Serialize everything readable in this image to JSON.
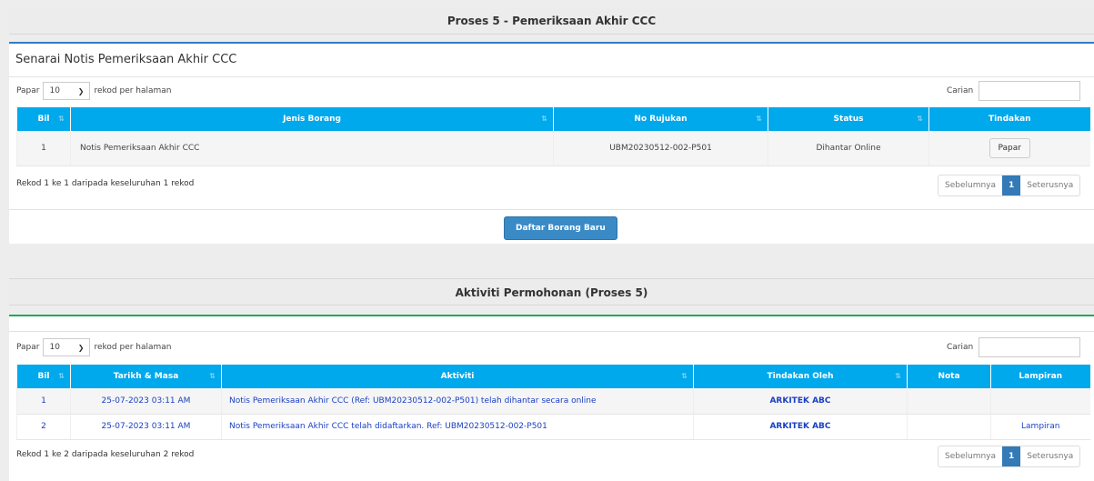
{
  "section1": {
    "header": "Proses 5 - Pemeriksaan Akhir CCC",
    "subtitle": "Senarai Notis Pemeriksaan Akhir CCC",
    "length": {
      "prefix": "Papar",
      "value": "10",
      "suffix": "rekod per halaman"
    },
    "search_label": "Carian",
    "columns": [
      "Bil",
      "Jenis Borang",
      "No Rujukan",
      "Status",
      "Tindakan"
    ],
    "rows": [
      {
        "bil": "1",
        "jenis": "Notis Pemeriksaan Akhir CCC",
        "rujukan": "UBM20230512-002-P501",
        "status": "Dihantar Online",
        "action": "Papar"
      }
    ],
    "info": "Rekod 1 ke 1 daripada keseluruhan 1 rekod",
    "pager": {
      "prev": "Sebelumnya",
      "current": "1",
      "next": "Seterusnya"
    },
    "new_button": "Daftar Borang Baru"
  },
  "section2": {
    "header": "Aktiviti Permohonan (Proses 5)",
    "length": {
      "prefix": "Papar",
      "value": "10",
      "suffix": "rekod per halaman"
    },
    "search_label": "Carian",
    "columns": [
      "Bil",
      "Tarikh & Masa",
      "Aktiviti",
      "Tindakan Oleh",
      "Nota",
      "Lampiran"
    ],
    "rows": [
      {
        "bil": "1",
        "tarikh": "25-07-2023 03:11 AM",
        "aktiviti": "Notis Pemeriksaan Akhir CCC (Ref: UBM20230512-002-P501) telah dihantar secara online",
        "oleh": "ARKITEK ABC",
        "nota": "",
        "lampiran": ""
      },
      {
        "bil": "2",
        "tarikh": "25-07-2023 03:11 AM",
        "aktiviti": "Notis Pemeriksaan Akhir CCC telah didaftarkan. Ref: UBM20230512-002-P501",
        "oleh": "ARKITEK ABC",
        "nota": "",
        "lampiran": "Lampiran"
      }
    ],
    "info": "Rekod 1 ke 2 daripada keseluruhan 2 rekod",
    "pager": {
      "prev": "Sebelumnya",
      "current": "1",
      "next": "Seterusnya"
    }
  },
  "colors": {
    "header_blue": "#00a8ec",
    "accent_blue": "#2f7ec2",
    "accent_green": "#1fa85a",
    "link": "#1a3fc4",
    "button": "#3a8ac6"
  }
}
